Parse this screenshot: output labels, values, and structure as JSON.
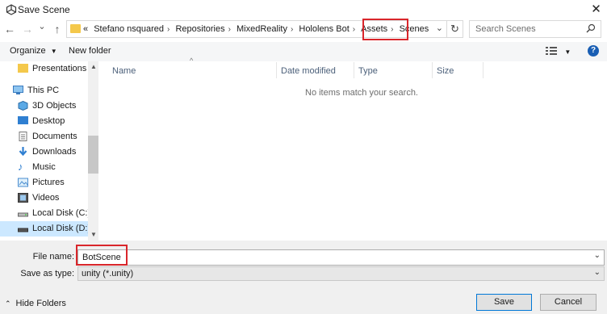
{
  "window": {
    "title": "Save Scene",
    "close_glyph": "✕"
  },
  "nav": {
    "back": "←",
    "forward": "→",
    "recent": "⌄",
    "up": "↑"
  },
  "address": {
    "prefix": "«",
    "crumbs": [
      "Stefano nsquared",
      "Repositories",
      "MixedReality",
      "Hololens Bot",
      "Assets",
      "Scenes"
    ],
    "dropdown": "⌄",
    "refresh": "↻"
  },
  "search": {
    "placeholder": "Search Scenes",
    "icon": "search-icon"
  },
  "toolbar": {
    "organize": "Organize",
    "new_folder": "New folder",
    "help": "?"
  },
  "sidebar": {
    "items": [
      {
        "label": "Presentations",
        "icon": "folder-icon"
      },
      {
        "label": "This PC",
        "icon": "computer-icon"
      },
      {
        "label": "3D Objects",
        "icon": "3d-objects-icon"
      },
      {
        "label": "Desktop",
        "icon": "desktop-icon"
      },
      {
        "label": "Documents",
        "icon": "documents-icon"
      },
      {
        "label": "Downloads",
        "icon": "downloads-icon"
      },
      {
        "label": "Music",
        "icon": "music-icon"
      },
      {
        "label": "Pictures",
        "icon": "pictures-icon"
      },
      {
        "label": "Videos",
        "icon": "videos-icon"
      },
      {
        "label": "Local Disk (C:)",
        "icon": "drive-icon"
      },
      {
        "label": "Local Disk (D:)",
        "icon": "drive-icon",
        "selected": true
      }
    ]
  },
  "list": {
    "columns": [
      "Name",
      "Date modified",
      "Type",
      "Size"
    ],
    "empty_message": "No items match your search."
  },
  "form": {
    "file_name_label": "File name:",
    "file_name_value": "BotScene",
    "save_type_label": "Save as type:",
    "save_type_value": "unity (*.unity)"
  },
  "footer": {
    "hide_folders": "Hide Folders",
    "save": "Save",
    "cancel": "Cancel"
  },
  "colors": {
    "highlight": "#d9262b",
    "folder": "#f4c84b",
    "selection": "#cce8ff",
    "help_blue": "#1a5fb4"
  }
}
